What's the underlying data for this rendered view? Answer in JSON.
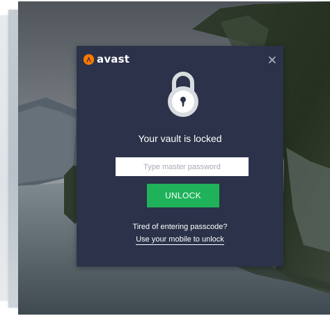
{
  "dialog": {
    "brand": "avast",
    "brand_icon": "avast-logo-icon",
    "close_icon": "close-icon",
    "lock_icon": "padlock-icon",
    "title": "Your vault is locked",
    "password_placeholder": "Type master password",
    "password_value": "",
    "unlock_label": "UNLOCK",
    "tired_text": "Tired of entering passcode?",
    "mobile_link_text": "Use your mobile to unlock"
  },
  "colors": {
    "dialog_bg": "#2b3249",
    "accent_orange": "#ff7800",
    "unlock_green": "#1fb25a",
    "text": "#ffffff"
  }
}
